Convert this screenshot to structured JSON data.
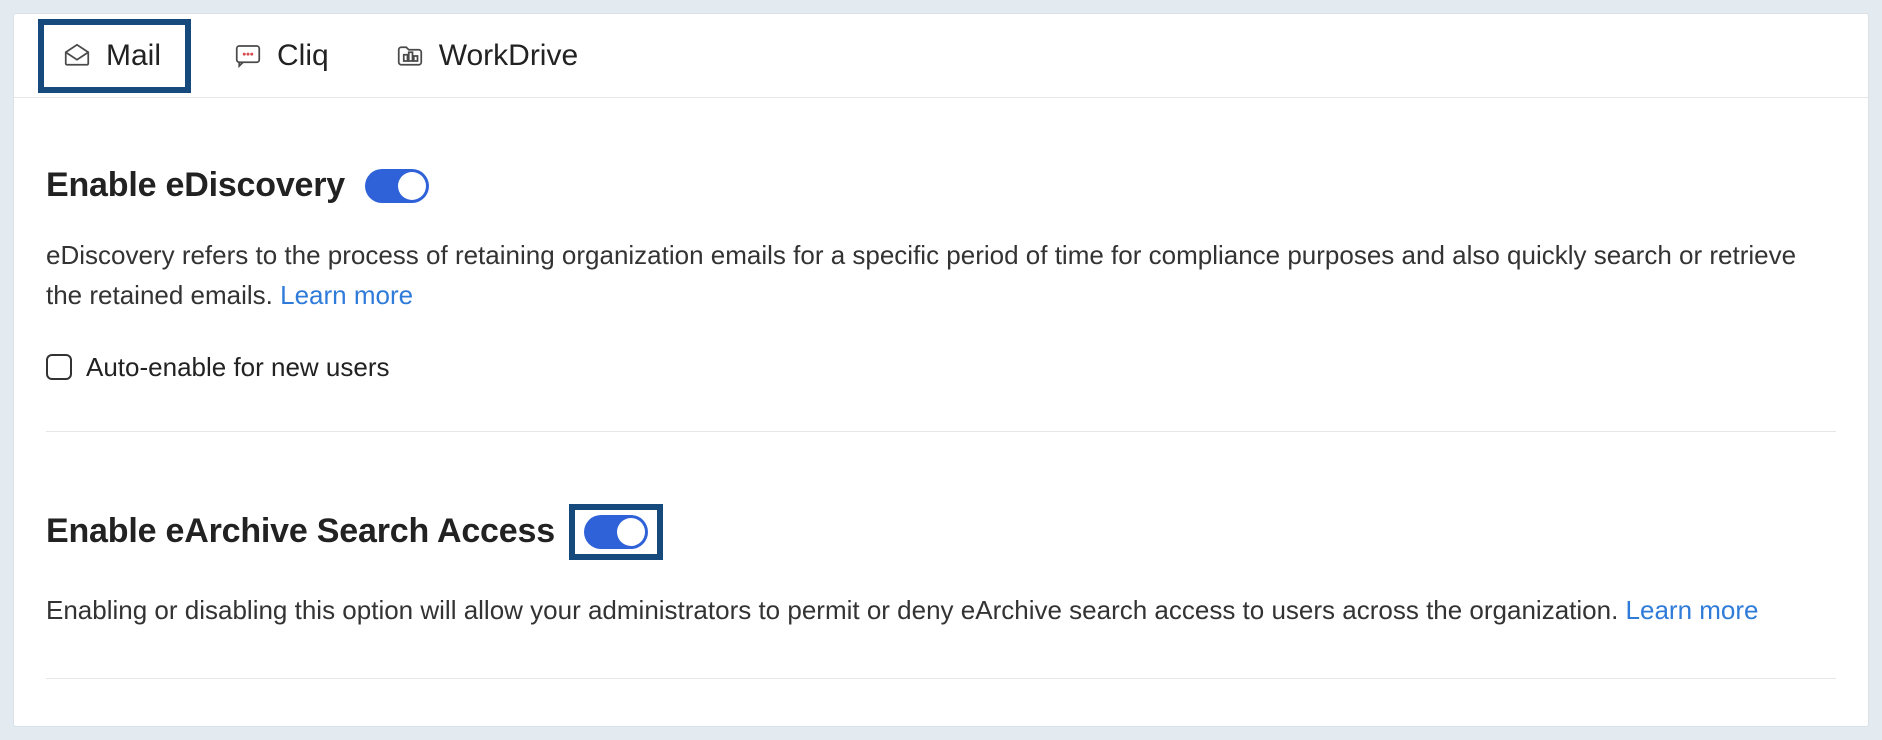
{
  "tabs": [
    {
      "label": "Mail",
      "icon": "mail-icon",
      "active": true
    },
    {
      "label": "Cliq",
      "icon": "chat-icon",
      "active": false
    },
    {
      "label": "WorkDrive",
      "icon": "workdrive-icon",
      "active": false
    }
  ],
  "ediscovery": {
    "title": "Enable eDiscovery",
    "toggle_on": true,
    "description": "eDiscovery refers to the process of retaining organization emails for a specific period of time for compliance purposes and also quickly search or retrieve the retained emails. ",
    "learn_more": "Learn more",
    "auto_enable_label": "Auto-enable for new users",
    "auto_enable_checked": false
  },
  "earchive": {
    "title": "Enable eArchive Search Access",
    "toggle_on": true,
    "toggle_highlighted": true,
    "description": "Enabling or disabling this option will allow your administrators to permit or deny eArchive search access to users across the organization. ",
    "learn_more": "Learn more"
  },
  "colors": {
    "highlight_border": "#174a7c",
    "toggle_fill": "#2f62d9",
    "link": "#2f7bd9"
  }
}
